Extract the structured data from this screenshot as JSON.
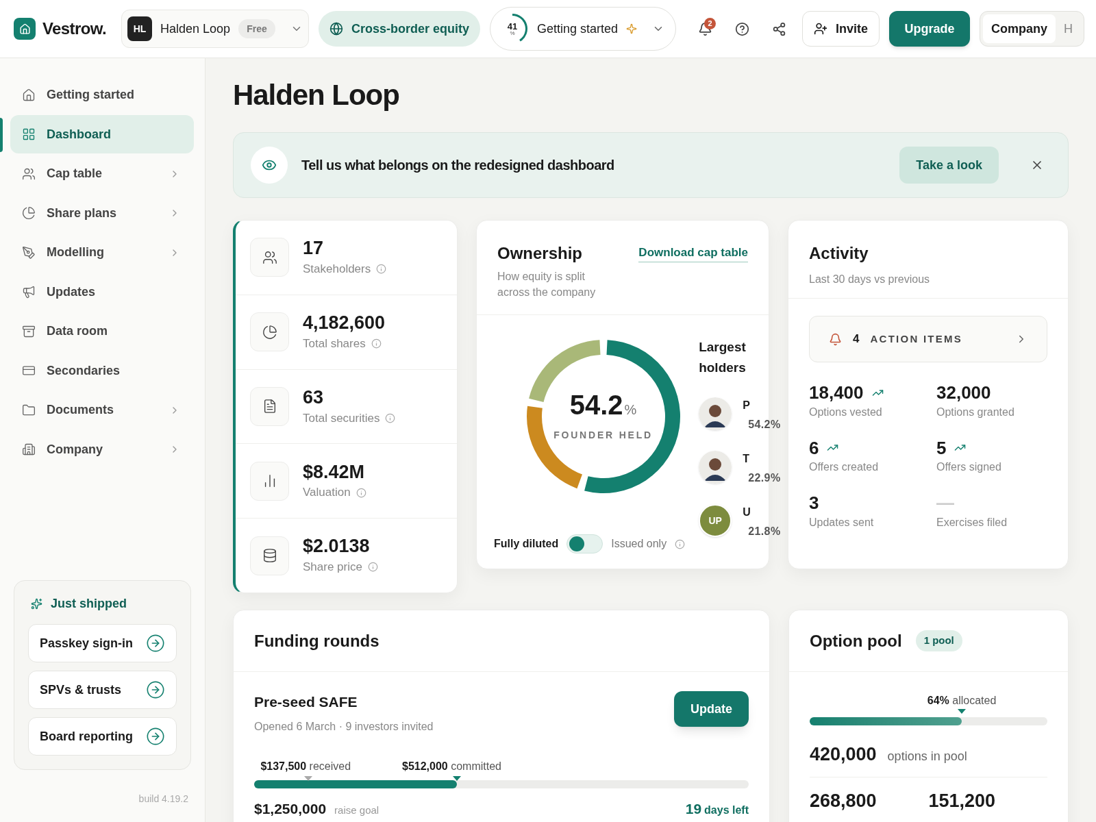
{
  "brand": "Vestrow.",
  "top_bar": {
    "workspace": {
      "initials": "HL",
      "name": "Halden Loop",
      "plan": "Free"
    },
    "feature": "Cross-border equity",
    "onboarding": {
      "progress": "41",
      "unit": "%",
      "level": 0.41,
      "label": "Getting started"
    },
    "notifications": {
      "count": "2"
    },
    "invite": "Invite",
    "upgrade": "Upgrade",
    "view_switch": [
      {
        "label": "Company",
        "selected": true
      },
      {
        "label": "H",
        "selected": false
      }
    ]
  },
  "sidebar": {
    "items": [
      {
        "label": "Getting started",
        "selected": false,
        "submenu": false
      },
      {
        "label": "Dashboard",
        "selected": true,
        "submenu": false
      },
      {
        "label": "Cap table",
        "selected": false,
        "submenu": true
      },
      {
        "label": "Share plans",
        "selected": false,
        "submenu": true
      },
      {
        "label": "Modelling",
        "selected": false,
        "submenu": true
      },
      {
        "label": "Updates",
        "selected": false,
        "submenu": false
      },
      {
        "label": "Data room",
        "selected": false,
        "submenu": false
      },
      {
        "label": "Secondaries",
        "selected": false,
        "submenu": false
      },
      {
        "label": "Documents",
        "selected": false,
        "submenu": true
      },
      {
        "label": "Company",
        "selected": false,
        "submenu": true
      }
    ],
    "just_shipped": {
      "title": "Just shipped",
      "items": [
        "Passkey sign-in",
        "SPVs & trusts",
        "Board reporting"
      ]
    },
    "build": "build 4.19.2"
  },
  "page_title": "Halden Loop",
  "banner": {
    "text": "Tell us what belongs on the redesigned dashboard",
    "action": "Take a look"
  },
  "stats": [
    {
      "value": "17",
      "label": "Stakeholders"
    },
    {
      "value": "4,182,600",
      "label": "Total shares"
    },
    {
      "value": "63",
      "label": "Total securities"
    },
    {
      "value": "$8.42M",
      "label": "Valuation"
    },
    {
      "value": "$2.0138",
      "label": "Share price"
    }
  ],
  "ownership": {
    "title": "Ownership",
    "subtitle": "How equity is split across the company",
    "link": "Download cap table",
    "center_value": "54.2",
    "center_unit": "%",
    "center_label": "FOUNDER HELD",
    "chart_data": {
      "type": "donut",
      "values": [
        54.2,
        22.9,
        21.8
      ]
    },
    "holders_title": "Largest holders",
    "holders": [
      {
        "name": "P",
        "share": "54.2%"
      },
      {
        "name": "T",
        "share": "22.9%"
      },
      {
        "name": "U",
        "share": "21.8%",
        "kind": "initials",
        "initials": "UP"
      }
    ],
    "basis": [
      {
        "label": "Fully diluted",
        "selected": true
      },
      {
        "label": "Issued only",
        "selected": false
      }
    ]
  },
  "activity": {
    "title": "Activity",
    "subtitle": "Last 30 days vs previous",
    "action_items": {
      "count": "4",
      "label": "ACTION ITEMS"
    },
    "metrics": [
      {
        "value": "18,400",
        "label": "Options vested",
        "trend_up": true
      },
      {
        "value": "32,000",
        "label": "Options granted",
        "trend_up": false
      },
      {
        "value": "6",
        "label": "Offers created",
        "trend_up": true
      },
      {
        "value": "5",
        "label": "Offers signed",
        "trend_up": true
      },
      {
        "value": "3",
        "label": "Updates sent",
        "trend_up": false
      },
      {
        "value": "—",
        "label": "Exercises filed",
        "trend_up": false
      }
    ]
  },
  "funding": {
    "title": "Funding rounds",
    "round": {
      "name": "Pre-seed SAFE",
      "meta": "Opened 6 March · 9 investors invited",
      "button": "Update",
      "markers": [
        {
          "amount": "$137,500",
          "label": "received",
          "level": 0.11
        },
        {
          "amount": "$512,000",
          "label": "committed",
          "level": 0.41
        }
      ],
      "fill": {
        "level": 0.41
      },
      "goal": "$1,250,000",
      "goal_label": "raise goal",
      "days": "19",
      "days_label": "days left"
    }
  },
  "option_pool": {
    "title": "Option pool",
    "badge": "1 pool",
    "allocated": {
      "value": "64%",
      "label": "allocated",
      "level": 0.64
    },
    "total": {
      "value": "420,000",
      "label": "options in pool"
    },
    "split": [
      "268,800",
      "151,200"
    ]
  }
}
